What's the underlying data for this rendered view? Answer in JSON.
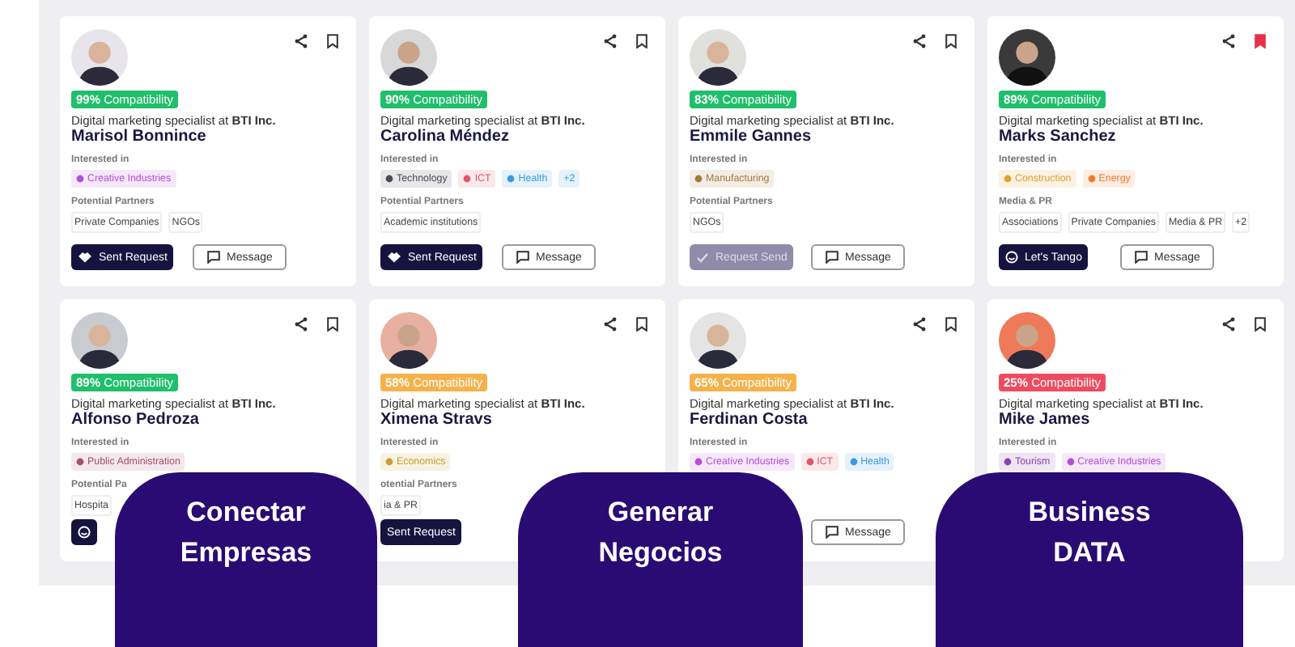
{
  "cards": [
    {
      "name": "Marisol Bonnince",
      "bookmarked": false,
      "compatibility": {
        "text": "**99%** Compatibility",
        "color": "#1fbf6b"
      },
      "role": "Digital marketing specialist at **BTI Inc.**",
      "interests_label": "Interested in",
      "interests": [
        {
          "kind": "category",
          "label": "Creative Industries",
          "color": "#b44fd8"
        }
      ],
      "partners_label": "Potential Partners",
      "partners": [
        "Private Companies",
        "NGOs"
      ],
      "buttons": [
        {
          "kind": "request",
          "label": "Sent Request",
          "disabled": false
        },
        {
          "kind": "message",
          "label": "Message"
        }
      ]
    },
    {
      "name": "Carolina Méndez",
      "bookmarked": false,
      "compatibility": {
        "text": "**90%** Compatibility",
        "color": "#1fbf6b"
      },
      "role": "Digital marketing specialist at **BTI Inc.**",
      "interests_label": "Interested in",
      "interests": [
        {
          "kind": "category",
          "label": "Technology",
          "color": "#4a4a5a"
        },
        {
          "kind": "category",
          "label": "ICT",
          "color": "#e0566a"
        },
        {
          "kind": "category",
          "label": "Health",
          "color": "#3a9be0"
        },
        {
          "kind": "count",
          "label": "+2",
          "color": "#3a9be0"
        }
      ],
      "partners_label": "Potential Partners",
      "partners": [
        "Academic institutions"
      ],
      "buttons": [
        {
          "kind": "request",
          "label": "Sent Request",
          "disabled": false
        },
        {
          "kind": "message",
          "label": "Message"
        }
      ]
    },
    {
      "name": "Emmile Gannes",
      "bookmarked": false,
      "compatibility": {
        "text": "**83%** Compatibility",
        "color": "#1fbf6b"
      },
      "role": "Digital marketing specialist at **BTI Inc.**",
      "interests_label": "Interested in",
      "interests": [
        {
          "kind": "category",
          "label": "Manufacturing",
          "color": "#a07a3c"
        }
      ],
      "partners_label": "Potential Partners",
      "partners": [
        "NGOs"
      ],
      "buttons": [
        {
          "kind": "done",
          "label": "Request Send",
          "disabled": true
        },
        {
          "kind": "message",
          "label": "Message"
        }
      ]
    },
    {
      "name": "Marks Sanchez",
      "bookmarked": true,
      "compatibility": {
        "text": "**89%** Compatibility",
        "color": "#1fbf6b"
      },
      "role": "Digital marketing specialist at **BTI Inc.**",
      "interests_label": "Interested in",
      "interests": [
        {
          "kind": "category",
          "label": "Construction",
          "color": "#e0a030"
        },
        {
          "kind": "category",
          "label": "Energy",
          "color": "#f07a2a"
        }
      ],
      "partners_label": "Media & PR",
      "partners": [
        "Associations",
        "Private Companies",
        "Media & PR",
        "+2"
      ],
      "buttons": [
        {
          "kind": "tango",
          "label": "Let's Tango",
          "disabled": false
        },
        {
          "kind": "message",
          "label": "Message"
        }
      ]
    },
    {
      "name": "Alfonso Pedroza",
      "bookmarked": false,
      "compatibility": {
        "text": "**89%** Compatibility",
        "color": "#1fbf6b"
      },
      "role": "Digital marketing specialist at **BTI Inc.**",
      "interests_label": "Interested in",
      "interests": [
        {
          "kind": "category",
          "label": "Public Administration",
          "color": "#a8506a"
        }
      ],
      "partners_label": "Potential Pa",
      "partners": [
        "Hospita"
      ],
      "buttons": [
        {
          "kind": "tango",
          "disabled": false
        }
      ]
    },
    {
      "name": "Ximena Stravs",
      "bookmarked": false,
      "compatibility": {
        "text": "**58%** Compatibility",
        "color": "#f5b24a"
      },
      "role": "Digital marketing specialist at **BTI Inc.**",
      "interests_label": "Interested in",
      "interests": [
        {
          "kind": "category",
          "label": "Economics",
          "color": "#c8a030"
        }
      ],
      "partners_label": "otential Partners",
      "partners": [
        "ia & PR"
      ],
      "buttons": [
        {
          "kind": "plain",
          "label": "Sent Request",
          "disabled": false
        }
      ]
    },
    {
      "name": "Ferdinan Costa",
      "bookmarked": false,
      "compatibility": {
        "text": "**65%** Compatibility",
        "color": "#f5b24a"
      },
      "role": "Digital marketing specialist at **BTI Inc.**",
      "interests_label": "Interested in",
      "interests": [
        {
          "kind": "category",
          "label": "Creative Industries",
          "color": "#b44fd8"
        },
        {
          "kind": "category",
          "label": "ICT",
          "color": "#e0566a"
        },
        {
          "kind": "category",
          "label": "Health",
          "color": "#3a9be0"
        }
      ],
      "buttons": [
        {
          "kind": "message",
          "label": "Message"
        }
      ]
    },
    {
      "name": "Mike James",
      "bookmarked": false,
      "compatibility": {
        "text": "**25%** Compatibility",
        "color": "#ef4b5f"
      },
      "role": "Digital marketing specialist at **BTI Inc.**",
      "interests_label": "Interested in",
      "interests": [
        {
          "kind": "category",
          "label": "Tourism",
          "color": "#8a44b0"
        },
        {
          "kind": "category",
          "label": "Creative Industries",
          "color": "#b44fd8"
        }
      ]
    }
  ],
  "banners": [
    {
      "lines": [
        "Conectar",
        "Empresas"
      ]
    },
    {
      "lines": [
        "Generar",
        "Negocios"
      ]
    },
    {
      "lines": [
        "Business",
        "DATA"
      ]
    }
  ]
}
